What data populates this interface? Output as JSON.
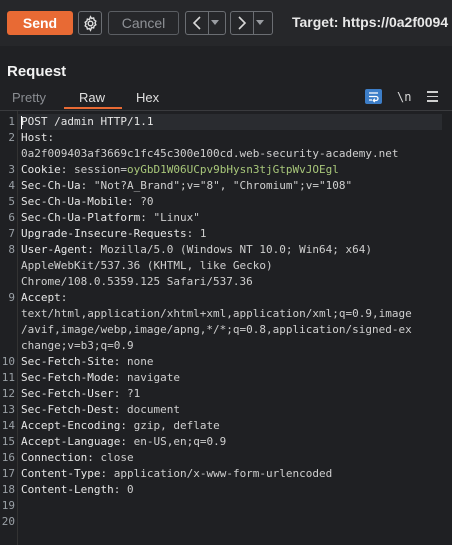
{
  "toolbar": {
    "send_label": "Send",
    "cancel_label": "Cancel",
    "prev_label": "<",
    "next_label": ">",
    "dropdown_glyph": "▾",
    "target_label": "Target: https://0a2f0094",
    "accent_color": "#e86a34"
  },
  "panel": {
    "title": "Request",
    "tabs": [
      {
        "label": "Pretty",
        "active": false
      },
      {
        "label": "Raw",
        "active": true
      },
      {
        "label": "Hex",
        "active": false
      }
    ],
    "icons": [
      "word-wrap-icon",
      "newline-icon",
      "menu-icon"
    ],
    "newline_label": "\\n"
  },
  "editor": {
    "line_numbers": [
      "1",
      "2",
      "",
      "3",
      "4",
      "5",
      "6",
      "7",
      "8",
      "",
      "",
      "9",
      "",
      "",
      "",
      "10",
      "11",
      "12",
      "13",
      "14",
      "15",
      "16",
      "17",
      "18",
      "19",
      "20"
    ],
    "lines": [
      {
        "key": "POST /admin HTTP/1.1",
        "sep": "",
        "value": ""
      },
      {
        "key": "Host",
        "sep": ":",
        "value": ""
      },
      {
        "key": "",
        "sep": "",
        "value": "0a2f009403af3669c1fc45c300e100cd.web-security-academy.net"
      },
      {
        "key": "Cookie",
        "sep": ":",
        "value": "session=",
        "value2": "oyGbD1W06UCpv9bHysn3tjGtpWvJOEgl"
      },
      {
        "key": "Sec-Ch-Ua",
        "sep": ":",
        "value": "\"Not?A_Brand\";v=\"8\", \"Chromium\";v=\"108\""
      },
      {
        "key": "Sec-Ch-Ua-Mobile",
        "sep": ":",
        "value": "?0"
      },
      {
        "key": "Sec-Ch-Ua-Platform",
        "sep": ":",
        "value": "\"Linux\""
      },
      {
        "key": "Upgrade-Insecure-Requests",
        "sep": ":",
        "value": "1"
      },
      {
        "key": "User-Agent",
        "sep": ":",
        "value": "Mozilla/5.0 (Windows NT 10.0; Win64; x64)"
      },
      {
        "key": "",
        "sep": "",
        "value": "AppleWebKit/537.36 (KHTML, like Gecko)"
      },
      {
        "key": "",
        "sep": "",
        "value": "Chrome/108.0.5359.125 Safari/537.36"
      },
      {
        "key": "Accept",
        "sep": ":",
        "value": ""
      },
      {
        "key": "",
        "sep": "",
        "value": "text/html,application/xhtml+xml,application/xml;q=0.9,image"
      },
      {
        "key": "",
        "sep": "",
        "value": "/avif,image/webp,image/apng,*/*;q=0.8,application/signed-ex"
      },
      {
        "key": "",
        "sep": "",
        "value": "change;v=b3;q=0.9"
      },
      {
        "key": "Sec-Fetch-Site",
        "sep": ":",
        "value": "none"
      },
      {
        "key": "Sec-Fetch-Mode",
        "sep": ":",
        "value": "navigate"
      },
      {
        "key": "Sec-Fetch-User",
        "sep": ":",
        "value": "?1"
      },
      {
        "key": "Sec-Fetch-Dest",
        "sep": ":",
        "value": "document"
      },
      {
        "key": "Accept-Encoding",
        "sep": ":",
        "value": "gzip, deflate"
      },
      {
        "key": "Accept-Language",
        "sep": ":",
        "value": "en-US,en;q=0.9"
      },
      {
        "key": "Connection",
        "sep": ":",
        "value": "close"
      },
      {
        "key": "Content-Type",
        "sep": ":",
        "value": "application/x-www-form-urlencoded"
      },
      {
        "key": "Content-Length",
        "sep": ":",
        "value": "0"
      },
      {
        "key": "",
        "sep": "",
        "value": ""
      },
      {
        "key": "",
        "sep": "",
        "value": ""
      }
    ]
  }
}
